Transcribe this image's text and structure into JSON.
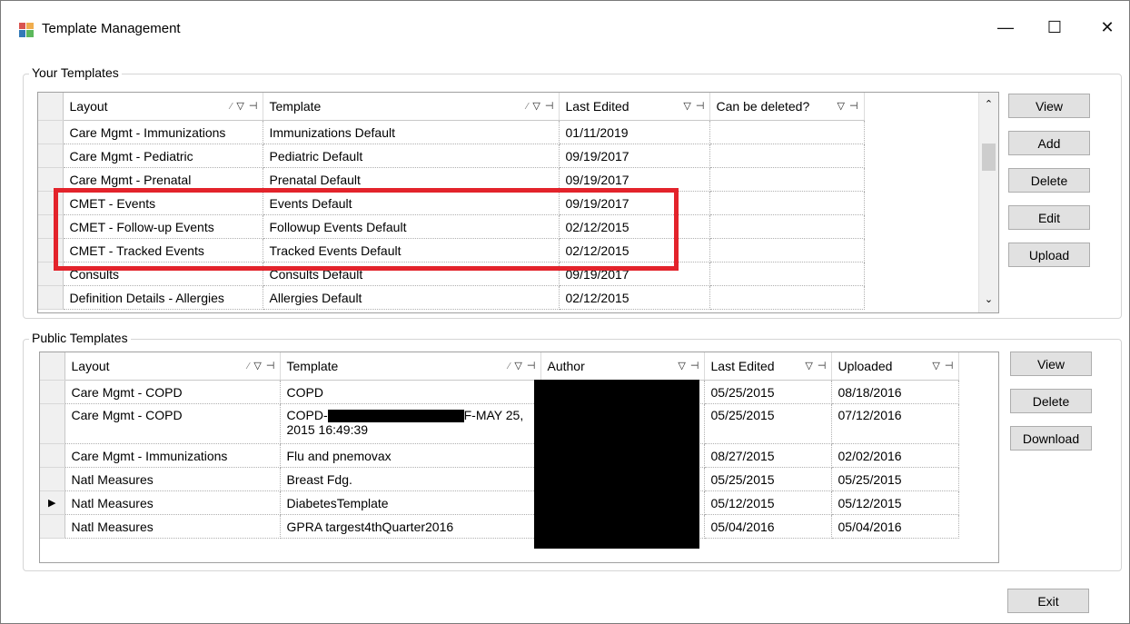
{
  "window": {
    "title": "Template Management",
    "minimize": "—",
    "maximize": "☐",
    "close": "✕"
  },
  "your_templates": {
    "label": "Your Templates",
    "columns": [
      "Layout",
      "Template",
      "Last Edited",
      "Can be deleted?"
    ],
    "rows": [
      [
        "Care Mgmt - Immunizations",
        "Immunizations Default",
        "01/11/2019",
        ""
      ],
      [
        "Care Mgmt - Pediatric",
        "Pediatric Default",
        "09/19/2017",
        ""
      ],
      [
        "Care Mgmt - Prenatal",
        "Prenatal Default",
        "09/19/2017",
        ""
      ],
      [
        "CMET - Events",
        "Events Default",
        "09/19/2017",
        ""
      ],
      [
        "CMET - Follow-up Events",
        "Followup Events Default",
        "02/12/2015",
        ""
      ],
      [
        "CMET - Tracked Events",
        "Tracked Events Default",
        "02/12/2015",
        ""
      ],
      [
        "Consults",
        "Consults Default",
        "09/19/2017",
        ""
      ],
      [
        "Definition Details - Allergies",
        "Allergies Default",
        "02/12/2015",
        ""
      ]
    ],
    "buttons": {
      "view": "View",
      "add": "Add",
      "delete": "Delete",
      "edit": "Edit",
      "upload": "Upload"
    },
    "highlight_color": "#e3232b"
  },
  "public_templates": {
    "label": "Public Templates",
    "columns": [
      "Layout",
      "Template",
      "Author",
      "Last Edited",
      "Uploaded"
    ],
    "rows": [
      [
        "Care Mgmt - COPD",
        "COPD",
        "",
        "05/25/2015",
        "08/18/2016"
      ],
      [
        "Care Mgmt - COPD",
        "COPD-",
        "",
        "05/25/2015",
        "07/12/2016"
      ],
      [
        "Care Mgmt - Immunizations",
        "Flu and pnemovax",
        "",
        "08/27/2015",
        "02/02/2016"
      ],
      [
        "Natl Measures",
        "Breast Fdg.",
        "",
        "05/25/2015",
        "05/25/2015"
      ],
      [
        "Natl Measures",
        "DiabetesTemplate",
        "",
        "05/12/2015",
        "05/12/2015"
      ],
      [
        "Natl Measures",
        "GPRA targest4thQuarter2016",
        "",
        "05/04/2016",
        "05/04/2016"
      ]
    ],
    "template_row2_tail": "F-MAY 25,",
    "template_row2_line2": "2015 16:49:39",
    "current_row_marker": "▶",
    "buttons": {
      "view": "View",
      "delete": "Delete",
      "download": "Download"
    }
  },
  "exit_button": "Exit",
  "icons": {
    "filter_pin": "filter-pin-icon",
    "scroll_up": "chevron-up-icon",
    "scroll_down": "chevron-down-icon"
  }
}
